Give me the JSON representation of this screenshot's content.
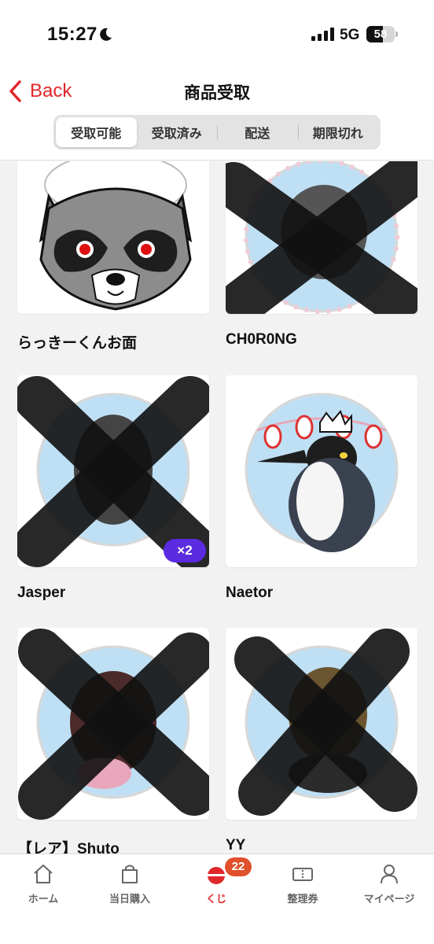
{
  "status_bar": {
    "time": "15:27",
    "network": "5G",
    "battery_level": "58",
    "battery_fraction": 0.58
  },
  "header": {
    "back_label": "Back",
    "title": "商品受取"
  },
  "tabs": [
    {
      "label": "受取可能",
      "active": true
    },
    {
      "label": "受取済み",
      "active": false
    },
    {
      "label": "配送",
      "active": false
    },
    {
      "label": "期限切れ",
      "active": false
    }
  ],
  "items": [
    {
      "name": "らっきーくんお面",
      "image": "raccoon-mask",
      "redacted": false
    },
    {
      "name": "CH0R0NG",
      "image": "can-badge",
      "redacted": true
    },
    {
      "name": "Jasper",
      "image": "can-badge",
      "redacted": true,
      "quantity_badge": "×2"
    },
    {
      "name": "Naetor",
      "image": "penguin-badge",
      "redacted": false
    },
    {
      "name": "【レア】Shuto",
      "image": "can-badge",
      "redacted": true
    },
    {
      "name": "YY",
      "image": "can-badge",
      "redacted": true
    }
  ],
  "bottom_tabs": [
    {
      "label": "ホーム",
      "icon": "home-icon"
    },
    {
      "label": "当日購入",
      "icon": "shopping-bag-icon"
    },
    {
      "label": "くじ",
      "icon": "lottery-icon",
      "badge": "22",
      "current": true
    },
    {
      "label": "整理券",
      "icon": "ticket-icon"
    },
    {
      "label": "マイページ",
      "icon": "person-icon"
    }
  ],
  "colors": {
    "accent": "#e0282a",
    "badge": "#5b2be0",
    "tab_badge": "#e0502a",
    "background": "#f2f2f2"
  }
}
